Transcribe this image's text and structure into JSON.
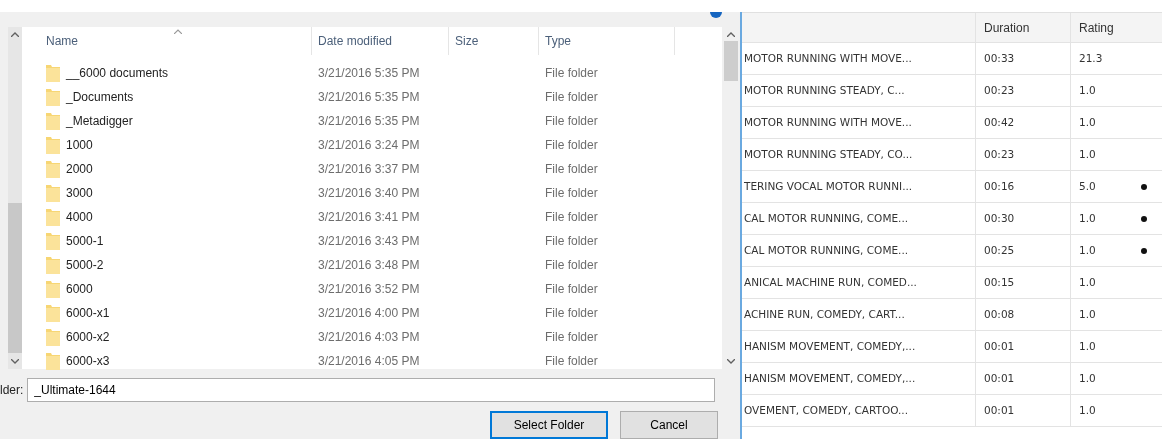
{
  "dialog": {
    "columns": [
      "Name",
      "Date modified",
      "Size",
      "Type"
    ],
    "folders": [
      {
        "name": "__6000 documents",
        "date": "3/21/2016 5:35 PM",
        "type": "File folder"
      },
      {
        "name": "_Documents",
        "date": "3/21/2016 5:35 PM",
        "type": "File folder"
      },
      {
        "name": "_Metadigger",
        "date": "3/21/2016 5:35 PM",
        "type": "File folder"
      },
      {
        "name": "1000",
        "date": "3/21/2016 3:24 PM",
        "type": "File folder"
      },
      {
        "name": "2000",
        "date": "3/21/2016 3:37 PM",
        "type": "File folder"
      },
      {
        "name": "3000",
        "date": "3/21/2016 3:40 PM",
        "type": "File folder"
      },
      {
        "name": "4000",
        "date": "3/21/2016 3:41 PM",
        "type": "File folder"
      },
      {
        "name": "5000-1",
        "date": "3/21/2016 3:43 PM",
        "type": "File folder"
      },
      {
        "name": "5000-2",
        "date": "3/21/2016 3:48 PM",
        "type": "File folder"
      },
      {
        "name": "6000",
        "date": "3/21/2016 3:52 PM",
        "type": "File folder"
      },
      {
        "name": "6000-x1",
        "date": "3/21/2016 4:00 PM",
        "type": "File folder"
      },
      {
        "name": "6000-x2",
        "date": "3/21/2016 4:03 PM",
        "type": "File folder"
      },
      {
        "name": "6000-x3",
        "date": "3/21/2016 4:05 PM",
        "type": "File folder"
      }
    ],
    "folder_label": "lder:",
    "folder_value": "_Ultimate-1644",
    "buttons": [
      "Select Folder",
      "Cancel"
    ]
  },
  "table": {
    "columns": [
      "Duration",
      "Rating"
    ],
    "rows": [
      {
        "title": "MOTOR RUNNING WITH MOVE...",
        "duration": "00:33",
        "rating": "21.3",
        "marked": false
      },
      {
        "title": "MOTOR RUNNING STEADY, C...",
        "duration": "00:23",
        "rating": "1.0",
        "marked": false
      },
      {
        "title": "MOTOR RUNNING WITH MOVE...",
        "duration": "00:42",
        "rating": "1.0",
        "marked": false
      },
      {
        "title": "MOTOR RUNNING STEADY, CO...",
        "duration": "00:23",
        "rating": "1.0",
        "marked": false
      },
      {
        "title": "TERING VOCAL MOTOR RUNNI...",
        "duration": "00:16",
        "rating": "5.0",
        "marked": true
      },
      {
        "title": "CAL MOTOR RUNNING, COME...",
        "duration": "00:30",
        "rating": "1.0",
        "marked": true
      },
      {
        "title": "CAL MOTOR RUNNING, COME...",
        "duration": "00:25",
        "rating": "1.0",
        "marked": true
      },
      {
        "title": "ANICAL MACHINE RUN, COMED...",
        "duration": "00:15",
        "rating": "1.0",
        "marked": false
      },
      {
        "title": "ACHINE RUN, COMEDY, CART...",
        "duration": "00:08",
        "rating": "1.0",
        "marked": false
      },
      {
        "title": "HANISM MOVEMENT, COMEDY,...",
        "duration": "00:01",
        "rating": "1.0",
        "marked": false
      },
      {
        "title": "HANISM MOVEMENT, COMEDY,...",
        "duration": "00:01",
        "rating": "1.0",
        "marked": false
      },
      {
        "title": "OVEMENT, COMEDY, CARTOO...",
        "duration": "00:01",
        "rating": "1.0",
        "marked": false
      }
    ]
  }
}
